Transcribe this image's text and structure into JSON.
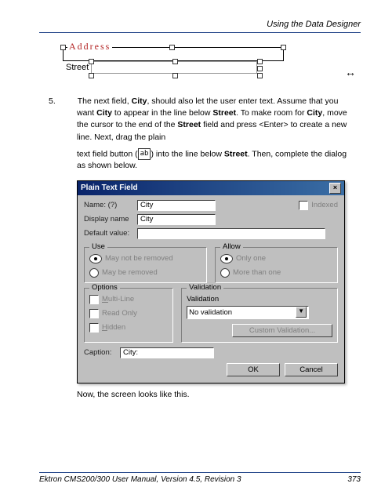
{
  "header": {
    "section_title": "Using the Data Designer"
  },
  "address_diagram": {
    "legend": "Address",
    "field_label": "Street"
  },
  "step": {
    "number": "5.",
    "text_line1_a": "The next field, ",
    "bold1": "City",
    "text_line1_b": ", should also let the user enter text. Assume that you want ",
    "bold2": "City",
    "text_line1_c": " to appear in the line below ",
    "bold3": "Street",
    "text_line1_d": ". To make room for ",
    "bold4": "City",
    "text_line1_e": ", move the cursor to the end of the ",
    "bold5": "Street",
    "text_line1_f": " field and press <Enter> to create a new line. Next, drag the plain",
    "text_line2_a": "text field button (",
    "icon_text": "ab",
    "text_line2_b": ") into the line below ",
    "bold6": "Street",
    "text_line2_c": ". Then, complete the dialog as shown below."
  },
  "dialog": {
    "title": "Plain Text Field",
    "name_label": "Name: (?)",
    "name_value": "City",
    "indexed_label": "Indexed",
    "display_label": "Display name",
    "display_value": "City",
    "default_label": "Default value:",
    "default_value": "",
    "use_group": "Use",
    "use_opt1": "May not be removed",
    "use_opt2": "May be removed",
    "allow_group": "Allow",
    "allow_opt1": "Only one",
    "allow_opt2": "More than one",
    "options_group": "Options",
    "opt_multiline": "Multi-Line",
    "opt_readonly": "Read Only",
    "opt_hidden": "Hidden",
    "validation_group": "Validation",
    "validation_label": "Validation",
    "validation_select": "No validation",
    "custom_btn": "Custom Validation...",
    "caption_label": "Caption:",
    "caption_value": "City:",
    "ok_btn": "OK",
    "cancel_btn": "Cancel"
  },
  "after_text": "Now, the screen looks like this.",
  "footer": {
    "left": "Ektron CMS200/300 User Manual, Version 4.5, Revision 3",
    "right": "373"
  }
}
